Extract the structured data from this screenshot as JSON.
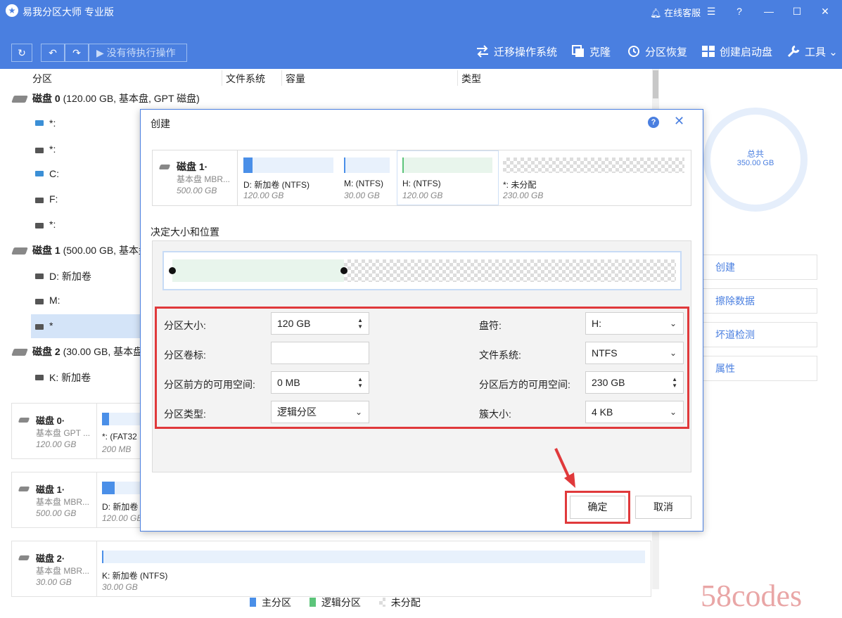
{
  "app": {
    "title": "易我分区大师 专业版",
    "support": "在线客服"
  },
  "toolbar": {
    "pending": "没有待执行操作",
    "tools": [
      "迁移操作系统",
      "克隆",
      "分区恢复",
      "创建启动盘",
      "工具"
    ]
  },
  "list": {
    "headers": [
      "分区",
      "文件系统",
      "容量",
      "类型"
    ],
    "rows": [
      {
        "name": "磁盘 0",
        "detail": "(120.00 GB, 基本盘, GPT 磁盘)"
      },
      {
        "label": "*:"
      },
      {
        "label": "*:"
      },
      {
        "label": "C:"
      },
      {
        "label": "F:"
      },
      {
        "label": "*:"
      },
      {
        "name": "磁盘 1",
        "detail": "(500.00 GB, 基本盘"
      },
      {
        "label": "D: 新加卷"
      },
      {
        "label": "M:"
      },
      {
        "label": "*"
      },
      {
        "name": "磁盘 2",
        "detail": "(30.00 GB, 基本盘"
      },
      {
        "label": "K: 新加卷"
      }
    ]
  },
  "cards": [
    {
      "name": "磁盘 0·",
      "sub": "基本盘 GPT ...",
      "size": "120.00 GB",
      "part_label": "*: (FAT32",
      "part_size": "200 MB"
    },
    {
      "name": "磁盘 1·",
      "sub": "基本盘 MBR...",
      "size": "500.00 GB",
      "part_label": "D: 新加卷",
      "part_size": "120.00 GB"
    },
    {
      "name": "磁盘 2·",
      "sub": "基本盘 MBR...",
      "size": "30.00 GB",
      "part_label": "K: 新加卷 (NTFS)",
      "part_size": "30.00 GB"
    }
  ],
  "legend": [
    "主分区",
    "逻辑分区",
    "未分配"
  ],
  "right_panel": {
    "total_label": "总共",
    "total_value": "350.00 GB",
    "actions": [
      "创建",
      "擦除数据",
      "坏道检测",
      "属性"
    ]
  },
  "dialog": {
    "title": "创建",
    "disk": {
      "name": "磁盘 1·",
      "sub": "基本盘 MBR...",
      "size": "500.00 GB"
    },
    "segments": [
      {
        "label": "D: 新加卷 (NTFS)",
        "size": "120.00 GB"
      },
      {
        "label": "M:  (NTFS)",
        "size": "30.00 GB"
      },
      {
        "label": "H:  (NTFS)",
        "size": "120.00 GB"
      },
      {
        "label": "*: 未分配",
        "size": "230.00 GB"
      }
    ],
    "section_label": "决定大小和位置",
    "fields": {
      "size_label": "分区大小:",
      "size_value": "120 GB",
      "volume_label": "分区卷标:",
      "volume_value": "",
      "before_label": "分区前方的可用空间:",
      "before_value": "0 MB",
      "type_label": "分区类型:",
      "type_value": "逻辑分区",
      "letter_label": "盘符:",
      "letter_value": "H:",
      "fs_label": "文件系统:",
      "fs_value": "NTFS",
      "after_label": "分区后方的可用空间:",
      "after_value": "230 GB",
      "cluster_label": "簇大小:",
      "cluster_value": "4 KB"
    },
    "confirm": "确定",
    "cancel": "取消"
  },
  "colors": {
    "accent": "#4a7fe0",
    "primary_partition": "#4a8fe8",
    "logical_partition": "#5cc47a",
    "highlight": "#e0393b"
  },
  "watermark": "58codes"
}
